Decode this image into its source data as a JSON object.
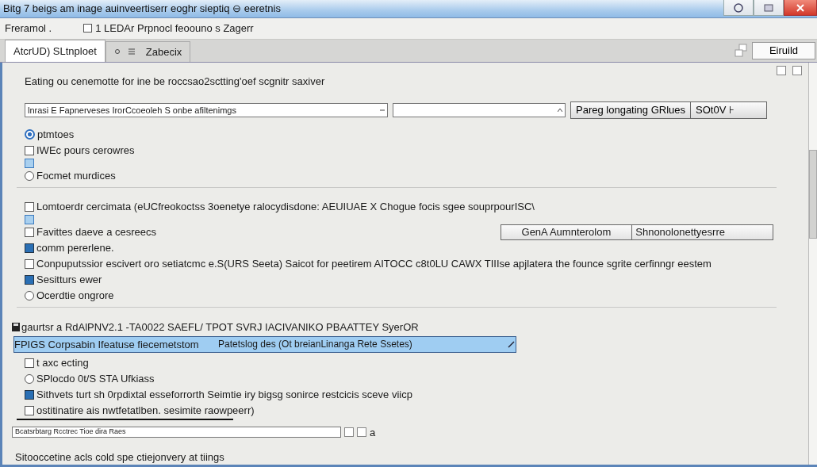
{
  "window": {
    "title": "Bitg 7 beigs am inage auinveertiserr eoghr sieptiq ⊖ eeretnis"
  },
  "menu": {
    "dropdown": "Freramol .",
    "checkbox": {
      "label": "1 LEDAr Prpnocl feoouno s Zagerr",
      "checked": false
    }
  },
  "tabs": [
    {
      "label": "AtcrUD) SLtnploet",
      "selected": true
    },
    {
      "label": "Zabecix",
      "selected": false
    }
  ],
  "toolbar_button": "Eiruild",
  "heading": "Eating ou cenemotte for ine be roccsao2sctting'oef scgnitr saxiver",
  "search_row": {
    "value": "lnrasi E Fapnerveses IrorCcoeoleh S onbe afiltenimgs",
    "buttons": [
      "Pareg longating GRlues",
      "SOt0V ⊦"
    ]
  },
  "groups": [
    {
      "items": [
        {
          "kind": "radio",
          "label": "ptmtoes",
          "checked": true
        },
        {
          "kind": "checkbox",
          "label": "IWEc pours cerowres",
          "checked": false
        },
        {
          "kind": "square"
        },
        {
          "kind": "radio",
          "label": "Focmet murdices",
          "checked": false
        }
      ]
    },
    {
      "items": [
        {
          "kind": "checkbox",
          "label": "Lomtoerdr cercimata (eUCfreokoctss 3oenetye ralocydisdone: AEUIUAE X Chogue focis sgee souprpourISC\\",
          "checked": false
        },
        {
          "kind": "square"
        },
        {
          "kind": "checkbox",
          "label": "Favittes daeve a cesreecs",
          "checked": false,
          "combo": [
            "GenA Aumnterolom",
            "Shnonolonettyesrre"
          ]
        },
        {
          "kind": "checkbox",
          "label": "comm pererlene.",
          "checked": true
        },
        {
          "kind": "checkbox",
          "label": "Conpuputssior escivert oro setiatcmc e.S(URS Seeta) Saicot for peetirem AITOCC c8t0LU CAWX TIIIse apjlatera the founce sgrite cerfinngr eestem",
          "checked": false
        },
        {
          "kind": "checkbox",
          "label": "Sesitturs ewer",
          "checked": true
        },
        {
          "kind": "radio",
          "label": "Ocerdtie ongrore",
          "checked": false
        }
      ]
    },
    {
      "header": "gaurtsr a RdAlPNV2.1 -TA0022 SAEFL/ TPOT SVRJ IACIVANIKO PBAATTEY SyerOR",
      "row": {
        "columns": [
          "FPIGS Corpsabin Ifeatuse fiecemetstom",
          "Patetslog des (Ot breianLinanga Rete Ssetes)"
        ],
        "selected": true
      },
      "items": [
        {
          "kind": "checkbox",
          "label": "t axc ecting",
          "checked": false
        },
        {
          "kind": "radio",
          "label": "SPlocdo 0t/S STA Ufkiass",
          "checked": false
        },
        {
          "kind": "checkbox",
          "label": "Sithvets turt sh 0rpdixtal esseforrorth Seimtie iry bigsg sonirce restcicis sceve viicp",
          "checked": true
        },
        {
          "kind": "checkbox",
          "label": "ostitinatire ais nwtfetatlben. sesimite raowpeerr)",
          "checked": false
        }
      ]
    }
  ],
  "bottom_field": {
    "value": "Bcatsrbtarg Rcctrec Tioe dira Raes",
    "suffix": "a"
  },
  "footer": "Sitooccetine acls cold spe ctiejonvery at tiings"
}
